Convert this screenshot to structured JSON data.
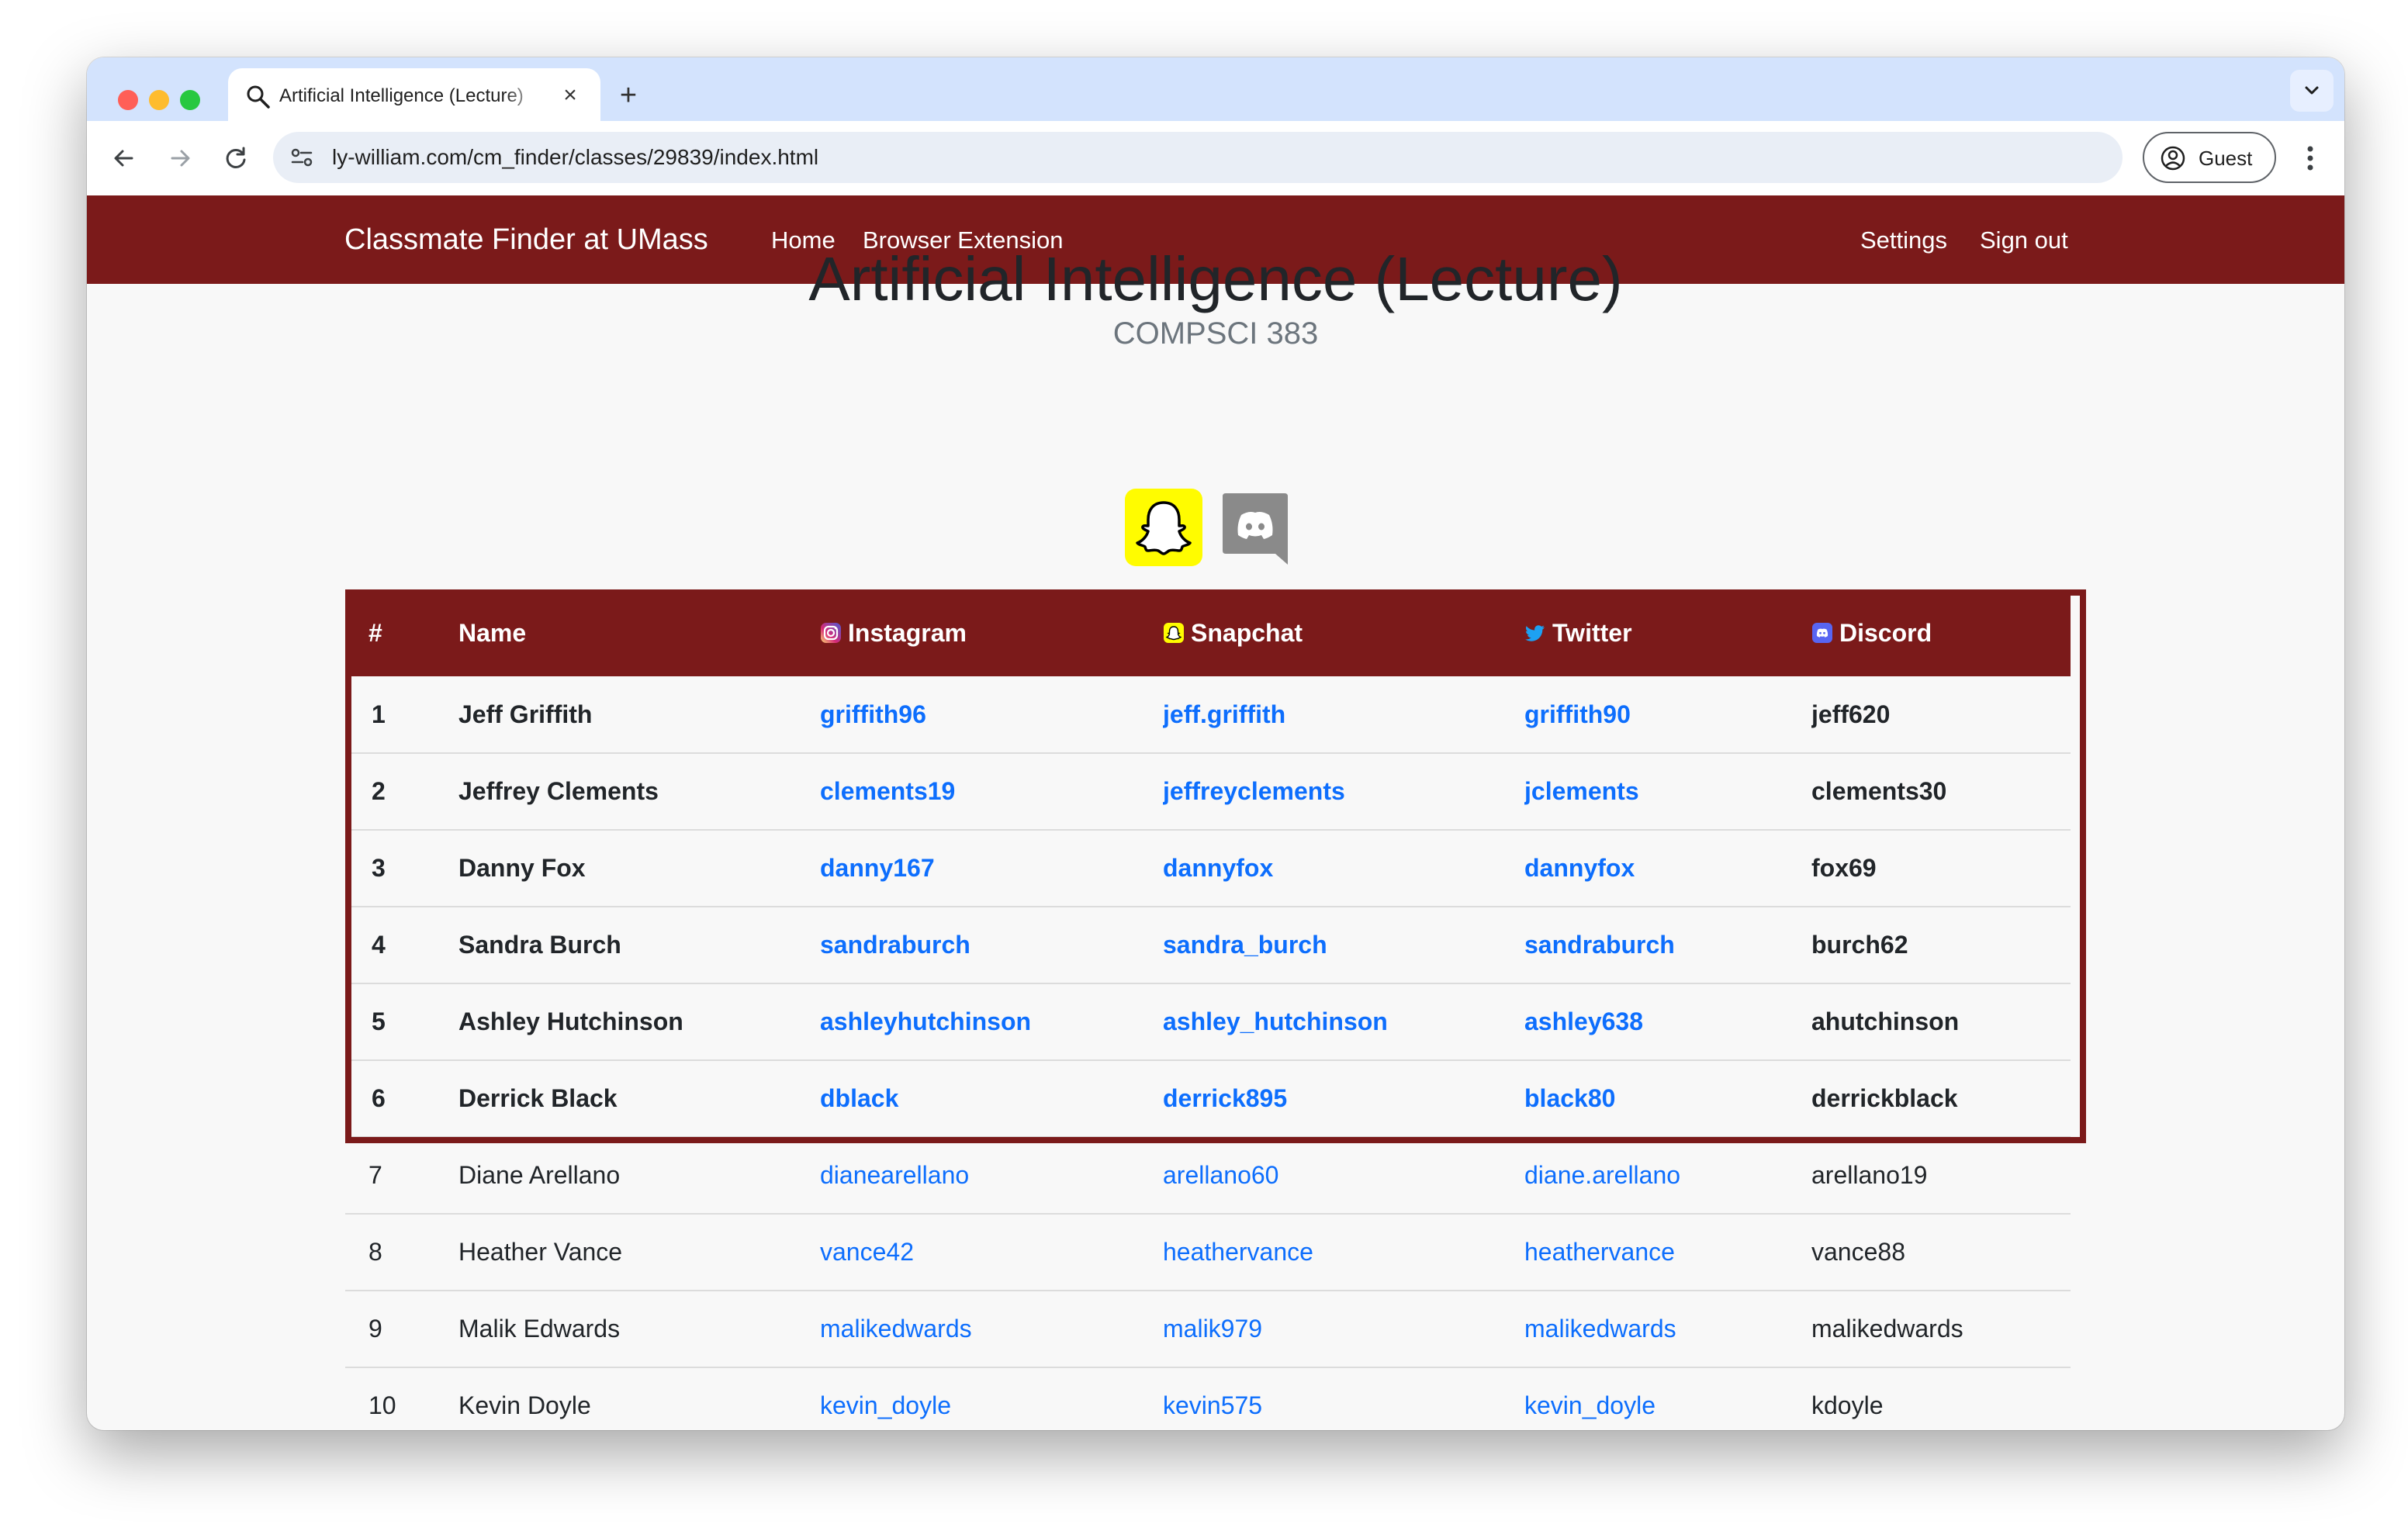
{
  "browser": {
    "tab_title": "Artificial Intelligence (Lecture)",
    "url": "ly-william.com/cm_finder/classes/29839/index.html",
    "profile_label": "Guest"
  },
  "navbar": {
    "brand": "Classmate Finder at UMass",
    "links": [
      "Home",
      "Browser Extension"
    ],
    "right_links": [
      "Settings",
      "Sign out"
    ]
  },
  "course": {
    "title": "Artificial Intelligence (Lecture)",
    "code": "COMPSCI 383"
  },
  "table": {
    "headers": [
      "#",
      "Name",
      "Instagram",
      "Snapchat",
      "Twitter",
      "Discord"
    ],
    "rows": [
      {
        "num": "1",
        "name": "Jeff Griffith",
        "instagram": "griffith96",
        "snapchat": "jeff.griffith",
        "twitter": "griffith90",
        "discord": "jeff620",
        "highlight": true
      },
      {
        "num": "2",
        "name": "Jeffrey Clements",
        "instagram": "clements19",
        "snapchat": "jeffreyclements",
        "twitter": "jclements",
        "discord": "clements30",
        "highlight": true
      },
      {
        "num": "3",
        "name": "Danny Fox",
        "instagram": "danny167",
        "snapchat": "dannyfox",
        "twitter": "dannyfox",
        "discord": "fox69",
        "highlight": true
      },
      {
        "num": "4",
        "name": "Sandra Burch",
        "instagram": "sandraburch",
        "snapchat": "sandra_burch",
        "twitter": "sandraburch",
        "discord": "burch62",
        "highlight": true
      },
      {
        "num": "5",
        "name": "Ashley Hutchinson",
        "instagram": "ashleyhutchinson",
        "snapchat": "ashley_hutchinson",
        "twitter": "ashley638",
        "discord": "ahutchinson",
        "highlight": true
      },
      {
        "num": "6",
        "name": "Derrick Black",
        "instagram": "dblack",
        "snapchat": "derrick895",
        "twitter": "black80",
        "discord": "derrickblack",
        "highlight": true
      },
      {
        "num": "7",
        "name": "Diane Arellano",
        "instagram": "dianearellano",
        "snapchat": "arellano60",
        "twitter": "diane.arellano",
        "discord": "arellano19",
        "highlight": false
      },
      {
        "num": "8",
        "name": "Heather Vance",
        "instagram": "vance42",
        "snapchat": "heathervance",
        "twitter": "heathervance",
        "discord": "vance88",
        "highlight": false
      },
      {
        "num": "9",
        "name": "Malik Edwards",
        "instagram": "malikedwards",
        "snapchat": "malik979",
        "twitter": "malikedwards",
        "discord": "malikedwards",
        "highlight": false
      },
      {
        "num": "10",
        "name": "Kevin Doyle",
        "instagram": "kevin_doyle",
        "snapchat": "kevin575",
        "twitter": "kevin_doyle",
        "discord": "kdoyle",
        "highlight": false
      }
    ]
  },
  "colors": {
    "brand": "#7b1a1a",
    "link": "#0d6efd",
    "snapchat": "#fffc00",
    "discord_badge": "#8a8a8a"
  },
  "icons": {
    "tab": "search-icon",
    "instagram": "instagram-icon",
    "snapchat": "snapchat-icon",
    "twitter": "twitter-icon",
    "discord": "discord-icon"
  }
}
